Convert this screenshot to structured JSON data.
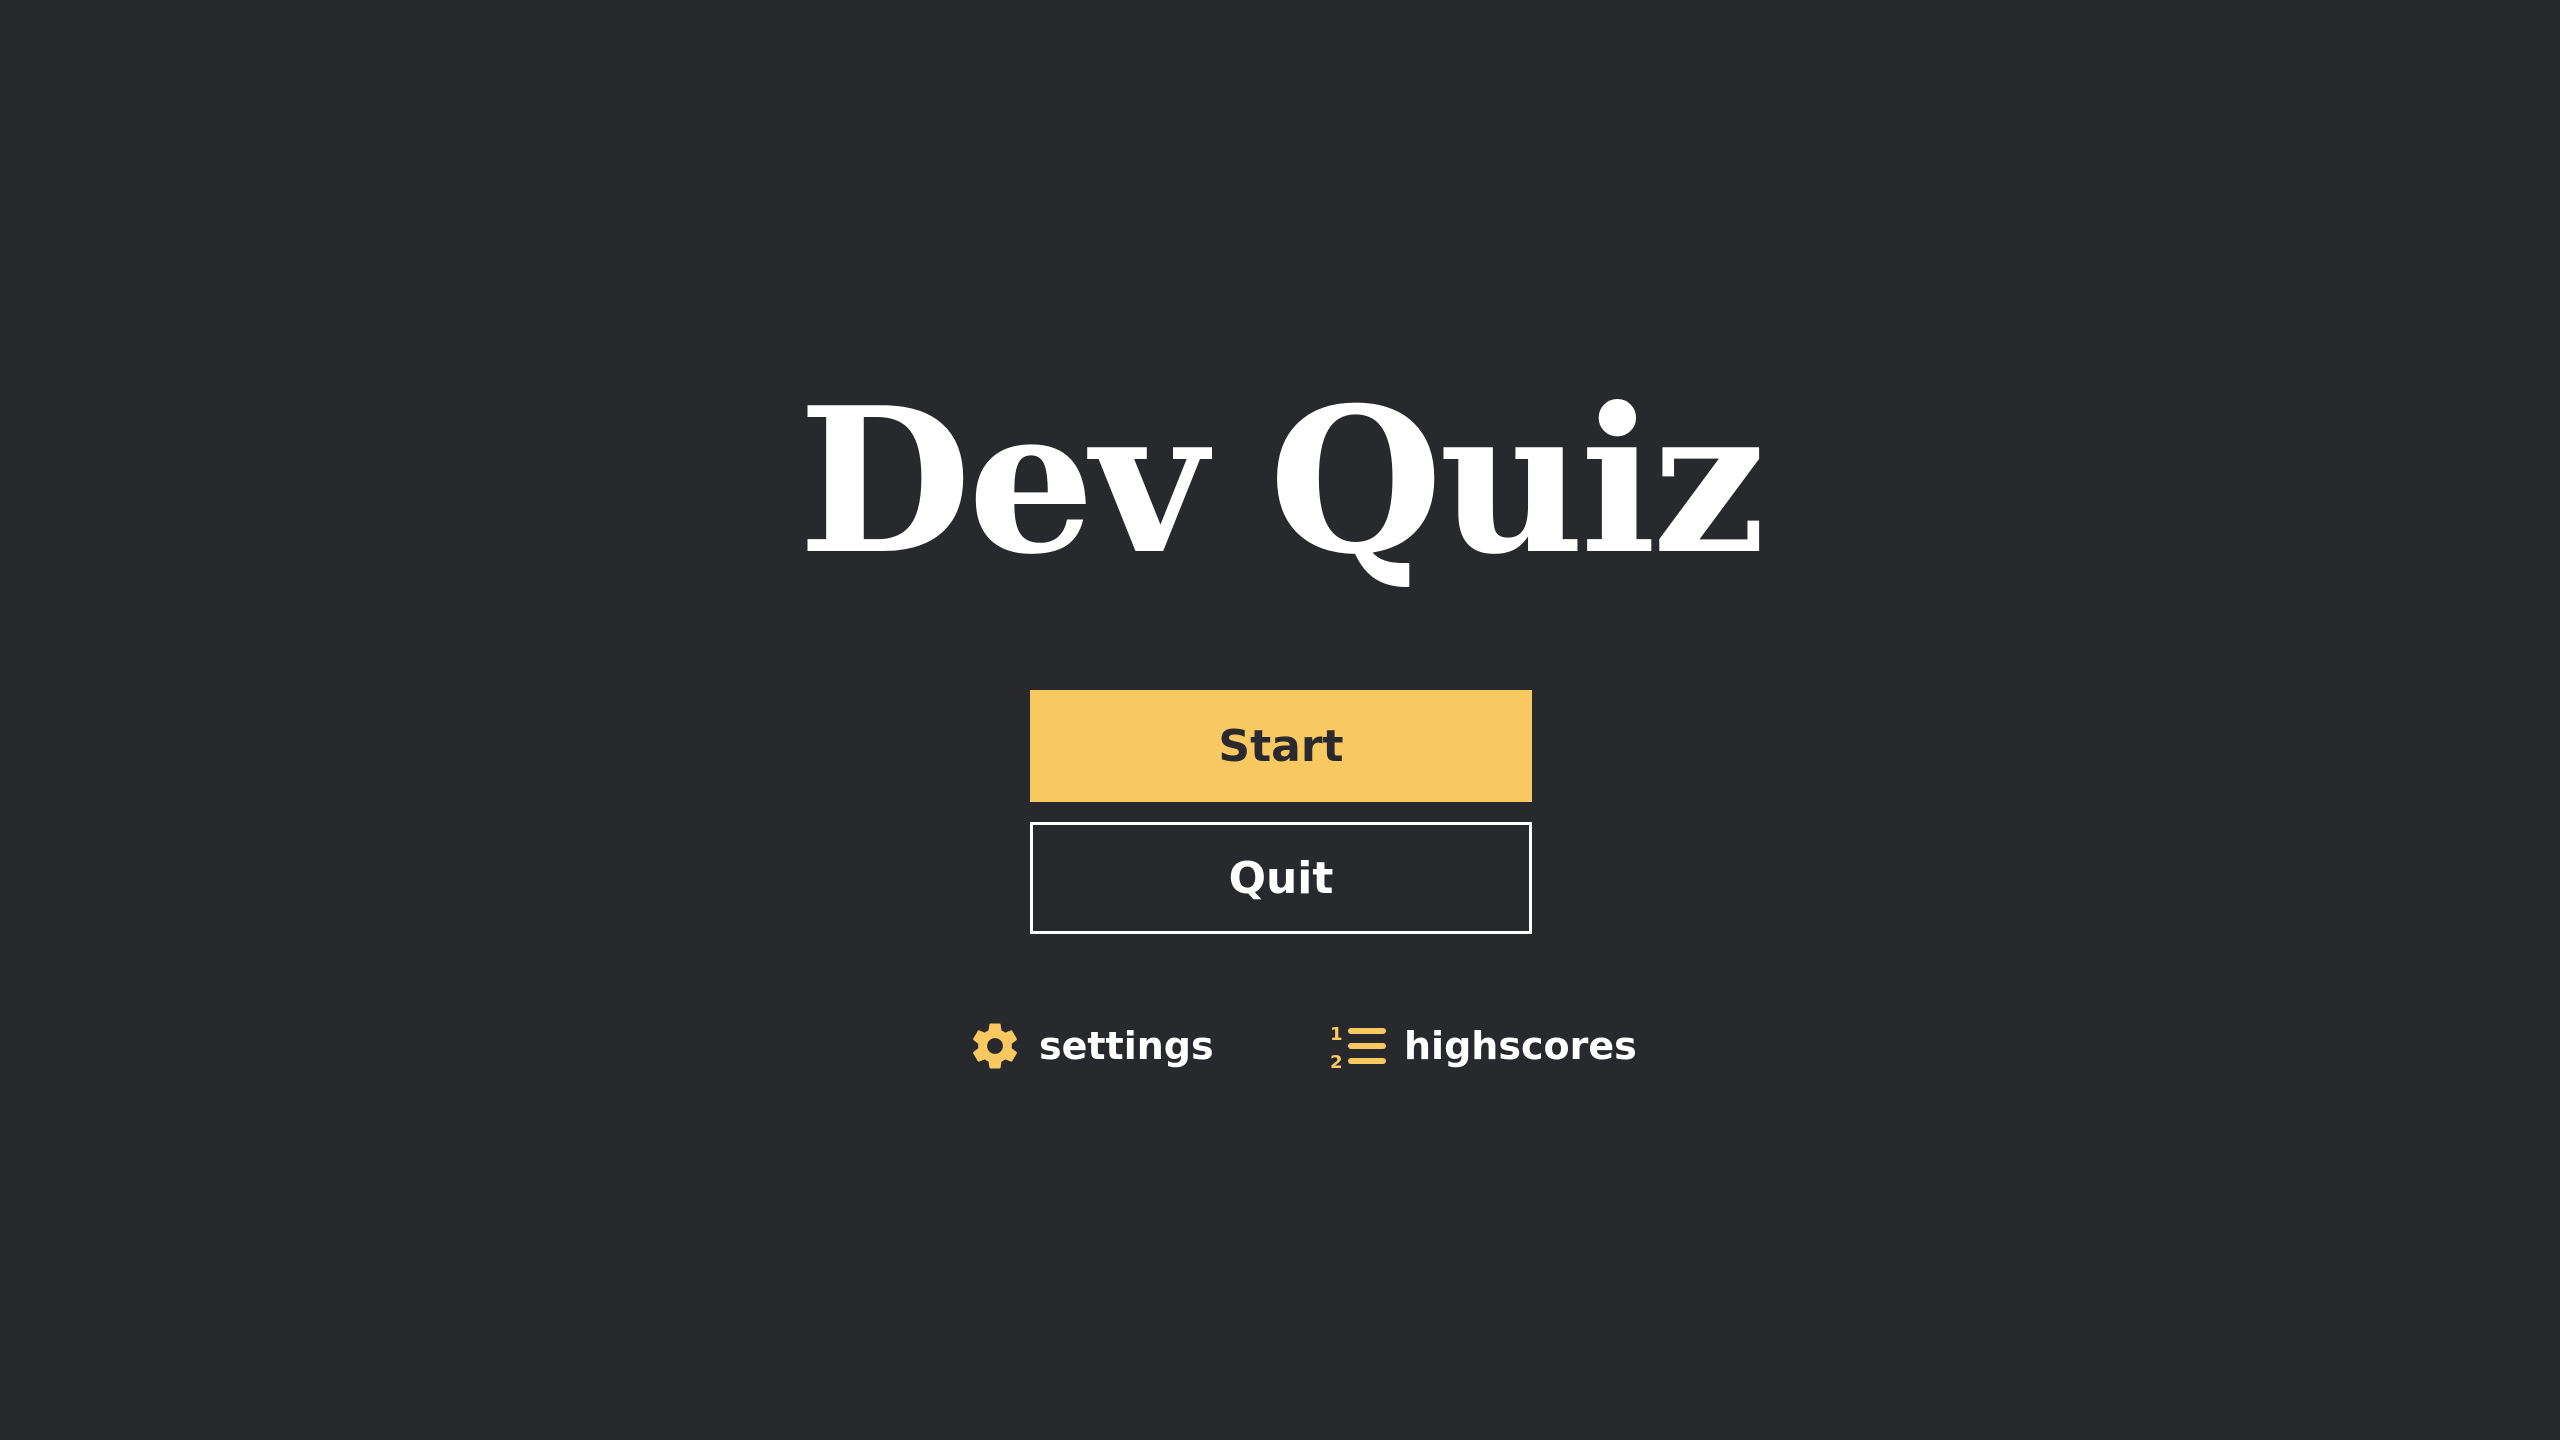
{
  "title": "Dev Quiz",
  "menu": {
    "start_label": "Start",
    "quit_label": "Quit"
  },
  "links": {
    "settings_label": "settings",
    "highscores_label": "highscores",
    "settings_icon": "gear-icon",
    "highscores_icon": "numbered-list-icon"
  },
  "colors": {
    "background": "#28292d",
    "accent": "#f8c961",
    "text": "#ffffff"
  }
}
